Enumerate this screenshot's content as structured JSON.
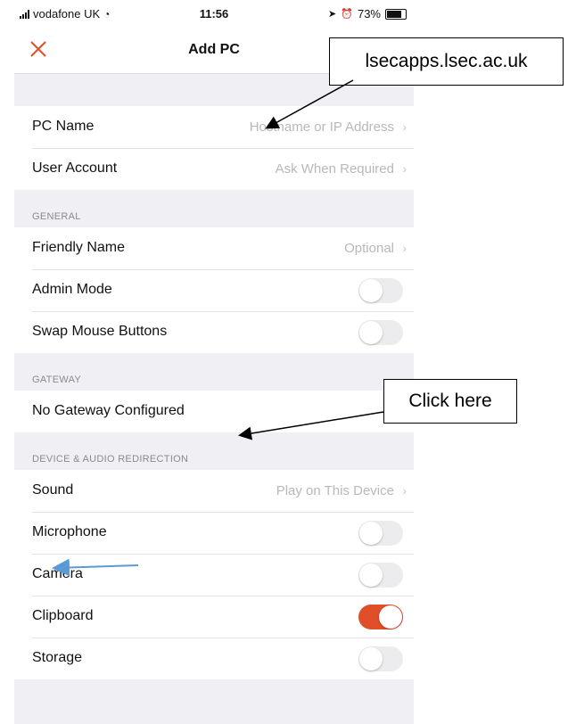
{
  "status_bar": {
    "carrier": "vodafone UK",
    "time": "11:56",
    "battery": "73%",
    "battery_level": 0.73
  },
  "nav": {
    "title": "Add PC",
    "close_icon": "close-icon",
    "accent": "#e04e2a"
  },
  "connection": {
    "pc_name": {
      "label": "PC Name",
      "placeholder": "Hostname or IP Address"
    },
    "user_account": {
      "label": "User Account",
      "value": "Ask When Required"
    }
  },
  "general": {
    "header": "GENERAL",
    "friendly_name": {
      "label": "Friendly Name",
      "placeholder": "Optional"
    },
    "admin_mode": {
      "label": "Admin Mode",
      "on": false
    },
    "swap_mouse": {
      "label": "Swap Mouse Buttons",
      "on": false
    }
  },
  "gateway": {
    "header": "GATEWAY",
    "row": {
      "label": "No Gateway Configured"
    }
  },
  "redirection": {
    "header": "DEVICE & AUDIO REDIRECTION",
    "sound": {
      "label": "Sound",
      "value": "Play on This Device"
    },
    "microphone": {
      "label": "Microphone",
      "on": false
    },
    "camera": {
      "label": "Camera",
      "on": false
    },
    "clipboard": {
      "label": "Clipboard",
      "on": true
    },
    "storage": {
      "label": "Storage",
      "on": false
    }
  },
  "annotations": {
    "server_callout": "lsecapps.lsec.ac.uk",
    "gateway_callout": "Click here",
    "arrow_color": "#000000",
    "mic_arrow_color": "#5b9bd5"
  }
}
